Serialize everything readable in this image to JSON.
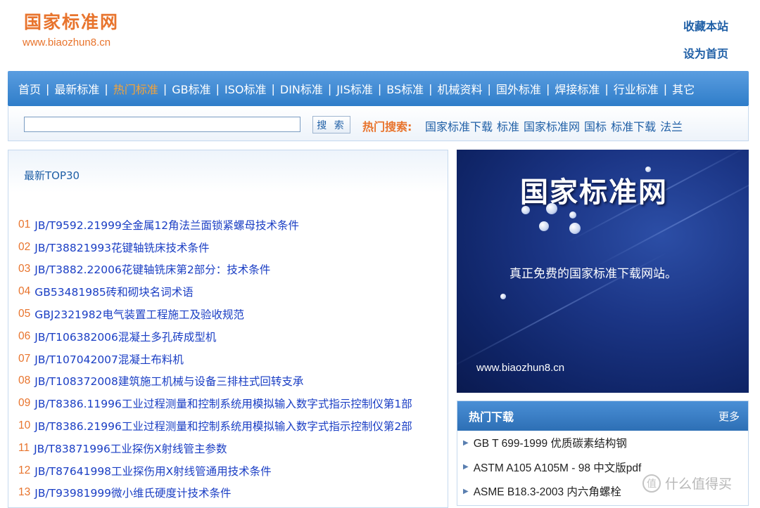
{
  "header": {
    "logo_title": "国家标准网",
    "logo_url": "www.biaozhun8.cn",
    "bookmark_label": "收藏本站",
    "homepage_label": "设为首页"
  },
  "nav": {
    "items": [
      "首页",
      "最新标准",
      "热门标准",
      "GB标准",
      "ISO标准",
      "DIN标准",
      "JIS标准",
      "BS标准",
      "机械资料",
      "国外标准",
      "焊接标准",
      "行业标准",
      "其它"
    ],
    "active": "热门标准"
  },
  "search": {
    "input_value": "",
    "button_label": "搜 索",
    "hot_label": "热门搜索:",
    "hot_links": [
      "国家标准下载",
      "标准",
      "国家标准网",
      "国标",
      "标准下载",
      "法兰"
    ]
  },
  "latest": {
    "title": "最新TOP30",
    "items": [
      {
        "num": "01",
        "text": "JB/T9592.21999全金属12角法兰面锁紧螺母技术条件"
      },
      {
        "num": "02",
        "text": "JB/T38821993花键轴铣床技术条件"
      },
      {
        "num": "03",
        "text": "JB/T3882.22006花键轴铣床第2部分：技术条件"
      },
      {
        "num": "04",
        "text": "GB53481985砖和砌块名词术语"
      },
      {
        "num": "05",
        "text": "GBJ2321982电气装置工程施工及验收规范"
      },
      {
        "num": "06",
        "text": "JB/T106382006混凝土多孔砖成型机"
      },
      {
        "num": "07",
        "text": "JB/T107042007混凝土布料机"
      },
      {
        "num": "08",
        "text": "JB/T108372008建筑施工机械与设备三排柱式回转支承"
      },
      {
        "num": "09",
        "text": "JB/T8386.11996工业过程测量和控制系统用模拟输入数字式指示控制仪第1部"
      },
      {
        "num": "10",
        "text": "JB/T8386.21996工业过程测量和控制系统用模拟输入数字式指示控制仪第2部"
      },
      {
        "num": "11",
        "text": "JB/T83871996工业探伤X射线管主参数"
      },
      {
        "num": "12",
        "text": "JB/T87641998工业探伤用X射线管通用技术条件"
      },
      {
        "num": "13",
        "text": "JB/T93981999微小维氏硬度计技术条件"
      }
    ]
  },
  "banner": {
    "title": "国家标准网",
    "subtitle": "真正免费的国家标准下载网站。",
    "url": "www.biaozhun8.cn"
  },
  "downloads": {
    "title": "热门下载",
    "more_label": "更多",
    "items": [
      "GB T 699-1999 优质碳素结构钢",
      "ASTM A105 A105M - 98 中文版pdf",
      "ASME B18.3-2003 内六角螺栓"
    ]
  },
  "watermark": {
    "icon": "值",
    "text": "什么值得买"
  },
  "colors": {
    "brand_orange": "#e8742d",
    "link_blue": "#1a3ec4",
    "nav_blue": "#2f7dc9"
  }
}
